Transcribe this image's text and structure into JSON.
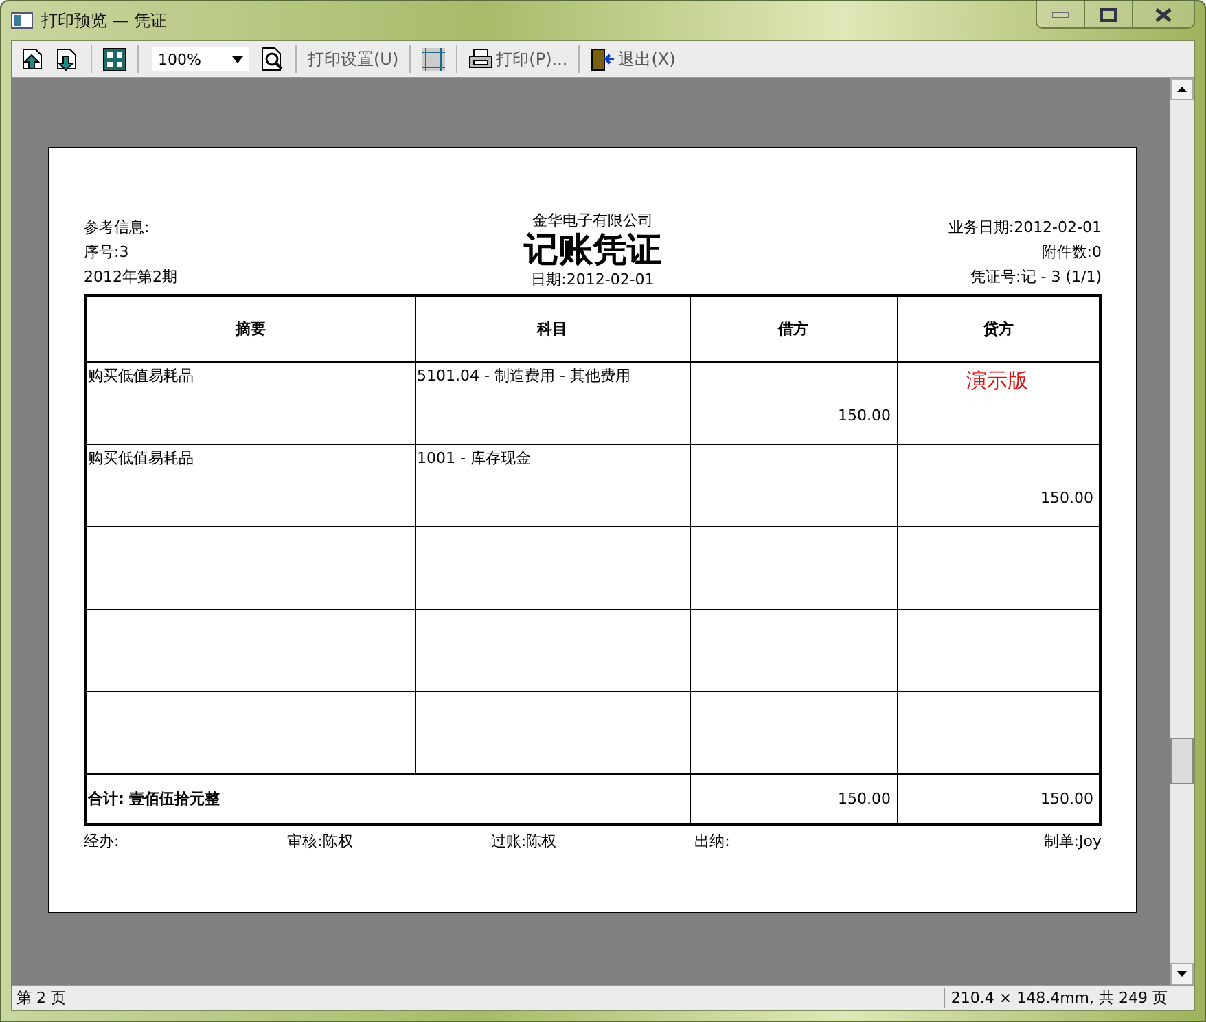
{
  "window": {
    "title": "打印预览 — 凭证"
  },
  "toolbar": {
    "zoom": "100%",
    "print_setup": "打印设置(U)",
    "print": "打印(P)...",
    "exit": "退出(X)"
  },
  "voucher": {
    "company": "金华电子有限公司",
    "title": "记账凭证",
    "date": "日期:2012-02-01",
    "left_info": [
      "参考信息:",
      "序号:3",
      "2012年第2期"
    ],
    "right_info": [
      "业务日期:2012-02-01",
      "附件数:0",
      "凭证号:记 - 3 (1/1)"
    ],
    "columns": [
      "摘要",
      "科目",
      "借方",
      "贷方"
    ],
    "rows": [
      {
        "summary": "购买低值易耗品",
        "account": "5101.04 - 制造费用 - 其他费用",
        "debit": "150.00",
        "stamp": "演示版"
      },
      {
        "summary": "购买低值易耗品",
        "account": "1001 - 库存现金",
        "credit": "150.00"
      },
      {},
      {},
      {}
    ],
    "total_label": "合计: 壹佰伍拾元整",
    "total_debit": "150.00",
    "total_credit": "150.00",
    "signatures": [
      "经办:",
      "审核:陈权",
      "过账:陈权",
      "出纳:",
      "制单:Joy"
    ]
  },
  "status_bar": {
    "page": "第 2 页",
    "info": "210.4 × 148.4mm, 共 249 页"
  }
}
